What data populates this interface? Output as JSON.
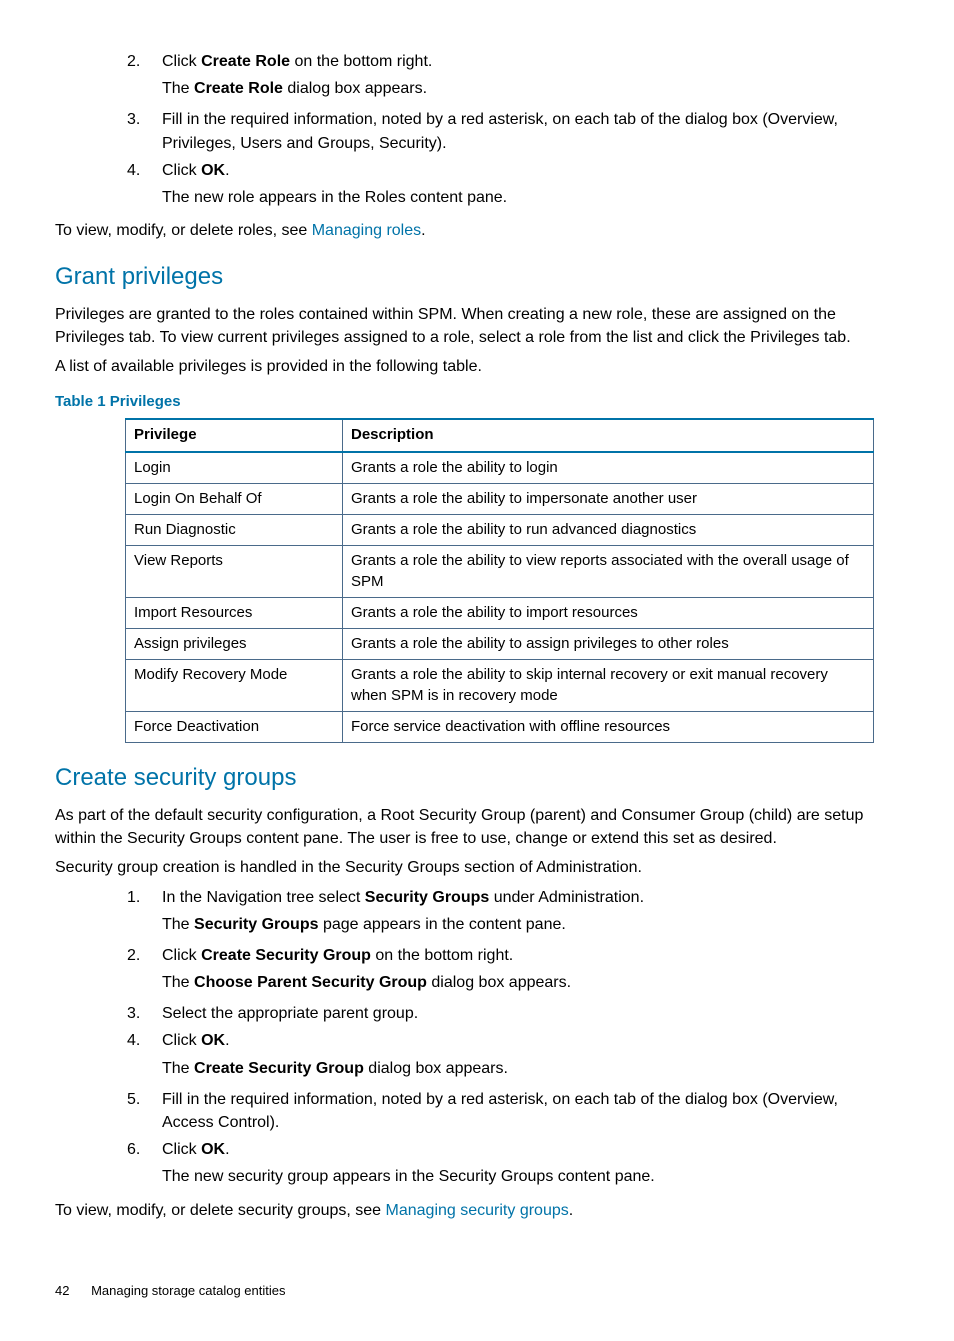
{
  "steps_top": [
    {
      "n": "2",
      "line1_pre": "Click ",
      "line1_b": "Create Role",
      "line1_post": " on the bottom right.",
      "line2_pre": "The ",
      "line2_b": "Create Role",
      "line2_post": " dialog box appears."
    },
    {
      "n": "3",
      "line1_pre": "Fill in the required information, noted by a red asterisk, on each tab of the dialog box (Overview, Privileges, Users and Groups, Security).",
      "line1_b": "",
      "line1_post": "",
      "line2_pre": "",
      "line2_b": "",
      "line2_post": ""
    },
    {
      "n": "4",
      "line1_pre": "Click ",
      "line1_b": "OK",
      "line1_post": ".",
      "line2_pre": "The new role appears in the Roles content pane.",
      "line2_b": "",
      "line2_post": ""
    }
  ],
  "roles_footer_pre": "To view, modify, or delete roles, see ",
  "roles_footer_link": "Managing roles",
  "roles_footer_post": ".",
  "grant_heading": "Grant privileges",
  "grant_p1": "Privileges are granted to the roles contained within SPM. When creating a new role, these are assigned on the Privileges tab. To view current privileges assigned to a role, select a role from the list and click the Privileges tab.",
  "grant_p2": "A list of available privileges is provided in the following table.",
  "table_caption": "Table 1 Privileges",
  "table_h1": "Privilege",
  "table_h2": "Description",
  "privileges": [
    {
      "p": "Login",
      "d": "Grants a role the ability to login"
    },
    {
      "p": "Login On Behalf Of",
      "d": "Grants a role the ability to impersonate another user"
    },
    {
      "p": "Run Diagnostic",
      "d": "Grants a role the ability to run advanced diagnostics"
    },
    {
      "p": "View Reports",
      "d": "Grants a role the ability to view reports associated with the overall usage of SPM"
    },
    {
      "p": "Import Resources",
      "d": "Grants a role the ability to import resources"
    },
    {
      "p": "Assign privileges",
      "d": "Grants a role the ability to assign privileges to other roles"
    },
    {
      "p": "Modify Recovery Mode",
      "d": "Grants a role the ability to skip internal recovery or exit manual recovery when SPM is in recovery mode"
    },
    {
      "p": "Force Deactivation",
      "d": "Force service deactivation with offline resources"
    }
  ],
  "sg_heading": "Create security groups",
  "sg_p1": "As part of the default security configuration, a Root Security Group (parent) and Consumer Group (child) are setup within the Security Groups content pane. The user is free to use, change or extend this set as desired.",
  "sg_p2": "Security group creation is handled in the Security Groups section of Administration.",
  "sg_steps": [
    {
      "n": "1",
      "line1_pre": "In the Navigation tree select ",
      "line1_b": "Security Groups",
      "line1_post": " under Administration.",
      "line2_pre": "The ",
      "line2_b": "Security Groups",
      "line2_post": " page appears in the content pane."
    },
    {
      "n": "2",
      "line1_pre": "Click ",
      "line1_b": "Create Security Group",
      "line1_post": " on the bottom right.",
      "line2_pre": "The ",
      "line2_b": "Choose Parent Security Group",
      "line2_post": " dialog box appears."
    },
    {
      "n": "3",
      "line1_pre": "Select the appropriate parent group.",
      "line1_b": "",
      "line1_post": "",
      "line2_pre": "",
      "line2_b": "",
      "line2_post": ""
    },
    {
      "n": "4",
      "line1_pre": "Click ",
      "line1_b": "OK",
      "line1_post": ".",
      "line2_pre": "The ",
      "line2_b": "Create Security Group",
      "line2_post": " dialog box appears."
    },
    {
      "n": "5",
      "line1_pre": "Fill in the required information, noted by a red asterisk, on each tab of the dialog box (Overview, Access Control).",
      "line1_b": "",
      "line1_post": "",
      "line2_pre": "",
      "line2_b": "",
      "line2_post": ""
    },
    {
      "n": "6",
      "line1_pre": "Click ",
      "line1_b": "OK",
      "line1_post": ".",
      "line2_pre": "The new security group appears in the Security Groups content pane.",
      "line2_b": "",
      "line2_post": ""
    }
  ],
  "sg_footer_pre": "To view, modify, or delete security groups, see ",
  "sg_footer_link": "Managing security groups",
  "sg_footer_post": ".",
  "page_number": "42",
  "page_title": "Managing storage catalog entities"
}
